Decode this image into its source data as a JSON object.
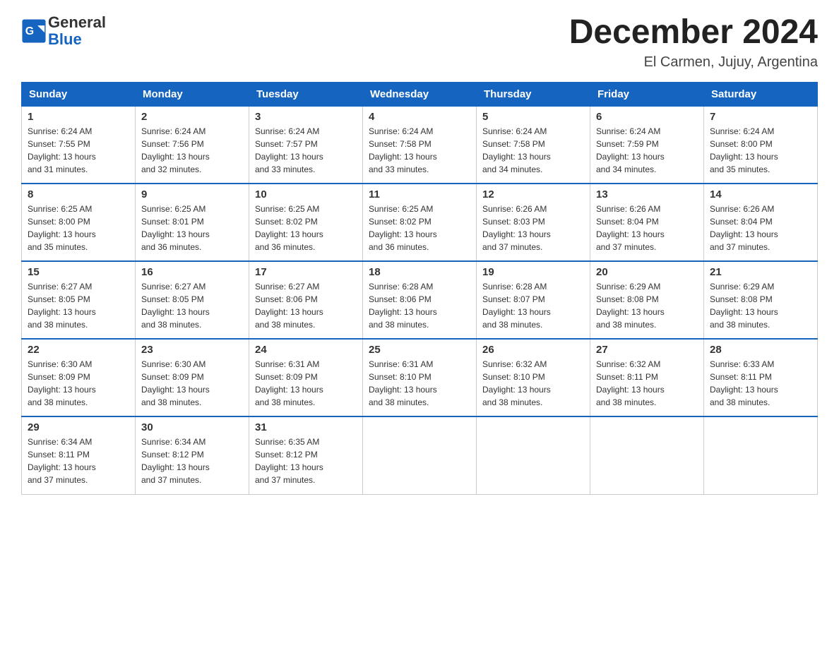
{
  "header": {
    "logo_text_general": "General",
    "logo_text_blue": "Blue",
    "month_title": "December 2024",
    "subtitle": "El Carmen, Jujuy, Argentina"
  },
  "days_of_week": [
    "Sunday",
    "Monday",
    "Tuesday",
    "Wednesday",
    "Thursday",
    "Friday",
    "Saturday"
  ],
  "weeks": [
    [
      {
        "day": "1",
        "sunrise": "6:24 AM",
        "sunset": "7:55 PM",
        "daylight": "13 hours and 31 minutes."
      },
      {
        "day": "2",
        "sunrise": "6:24 AM",
        "sunset": "7:56 PM",
        "daylight": "13 hours and 32 minutes."
      },
      {
        "day": "3",
        "sunrise": "6:24 AM",
        "sunset": "7:57 PM",
        "daylight": "13 hours and 33 minutes."
      },
      {
        "day": "4",
        "sunrise": "6:24 AM",
        "sunset": "7:58 PM",
        "daylight": "13 hours and 33 minutes."
      },
      {
        "day": "5",
        "sunrise": "6:24 AM",
        "sunset": "7:58 PM",
        "daylight": "13 hours and 34 minutes."
      },
      {
        "day": "6",
        "sunrise": "6:24 AM",
        "sunset": "7:59 PM",
        "daylight": "13 hours and 34 minutes."
      },
      {
        "day": "7",
        "sunrise": "6:24 AM",
        "sunset": "8:00 PM",
        "daylight": "13 hours and 35 minutes."
      }
    ],
    [
      {
        "day": "8",
        "sunrise": "6:25 AM",
        "sunset": "8:00 PM",
        "daylight": "13 hours and 35 minutes."
      },
      {
        "day": "9",
        "sunrise": "6:25 AM",
        "sunset": "8:01 PM",
        "daylight": "13 hours and 36 minutes."
      },
      {
        "day": "10",
        "sunrise": "6:25 AM",
        "sunset": "8:02 PM",
        "daylight": "13 hours and 36 minutes."
      },
      {
        "day": "11",
        "sunrise": "6:25 AM",
        "sunset": "8:02 PM",
        "daylight": "13 hours and 36 minutes."
      },
      {
        "day": "12",
        "sunrise": "6:26 AM",
        "sunset": "8:03 PM",
        "daylight": "13 hours and 37 minutes."
      },
      {
        "day": "13",
        "sunrise": "6:26 AM",
        "sunset": "8:04 PM",
        "daylight": "13 hours and 37 minutes."
      },
      {
        "day": "14",
        "sunrise": "6:26 AM",
        "sunset": "8:04 PM",
        "daylight": "13 hours and 37 minutes."
      }
    ],
    [
      {
        "day": "15",
        "sunrise": "6:27 AM",
        "sunset": "8:05 PM",
        "daylight": "13 hours and 38 minutes."
      },
      {
        "day": "16",
        "sunrise": "6:27 AM",
        "sunset": "8:05 PM",
        "daylight": "13 hours and 38 minutes."
      },
      {
        "day": "17",
        "sunrise": "6:27 AM",
        "sunset": "8:06 PM",
        "daylight": "13 hours and 38 minutes."
      },
      {
        "day": "18",
        "sunrise": "6:28 AM",
        "sunset": "8:06 PM",
        "daylight": "13 hours and 38 minutes."
      },
      {
        "day": "19",
        "sunrise": "6:28 AM",
        "sunset": "8:07 PM",
        "daylight": "13 hours and 38 minutes."
      },
      {
        "day": "20",
        "sunrise": "6:29 AM",
        "sunset": "8:08 PM",
        "daylight": "13 hours and 38 minutes."
      },
      {
        "day": "21",
        "sunrise": "6:29 AM",
        "sunset": "8:08 PM",
        "daylight": "13 hours and 38 minutes."
      }
    ],
    [
      {
        "day": "22",
        "sunrise": "6:30 AM",
        "sunset": "8:09 PM",
        "daylight": "13 hours and 38 minutes."
      },
      {
        "day": "23",
        "sunrise": "6:30 AM",
        "sunset": "8:09 PM",
        "daylight": "13 hours and 38 minutes."
      },
      {
        "day": "24",
        "sunrise": "6:31 AM",
        "sunset": "8:09 PM",
        "daylight": "13 hours and 38 minutes."
      },
      {
        "day": "25",
        "sunrise": "6:31 AM",
        "sunset": "8:10 PM",
        "daylight": "13 hours and 38 minutes."
      },
      {
        "day": "26",
        "sunrise": "6:32 AM",
        "sunset": "8:10 PM",
        "daylight": "13 hours and 38 minutes."
      },
      {
        "day": "27",
        "sunrise": "6:32 AM",
        "sunset": "8:11 PM",
        "daylight": "13 hours and 38 minutes."
      },
      {
        "day": "28",
        "sunrise": "6:33 AM",
        "sunset": "8:11 PM",
        "daylight": "13 hours and 38 minutes."
      }
    ],
    [
      {
        "day": "29",
        "sunrise": "6:34 AM",
        "sunset": "8:11 PM",
        "daylight": "13 hours and 37 minutes."
      },
      {
        "day": "30",
        "sunrise": "6:34 AM",
        "sunset": "8:12 PM",
        "daylight": "13 hours and 37 minutes."
      },
      {
        "day": "31",
        "sunrise": "6:35 AM",
        "sunset": "8:12 PM",
        "daylight": "13 hours and 37 minutes."
      },
      null,
      null,
      null,
      null
    ]
  ],
  "labels": {
    "sunrise": "Sunrise:",
    "sunset": "Sunset:",
    "daylight": "Daylight:"
  }
}
